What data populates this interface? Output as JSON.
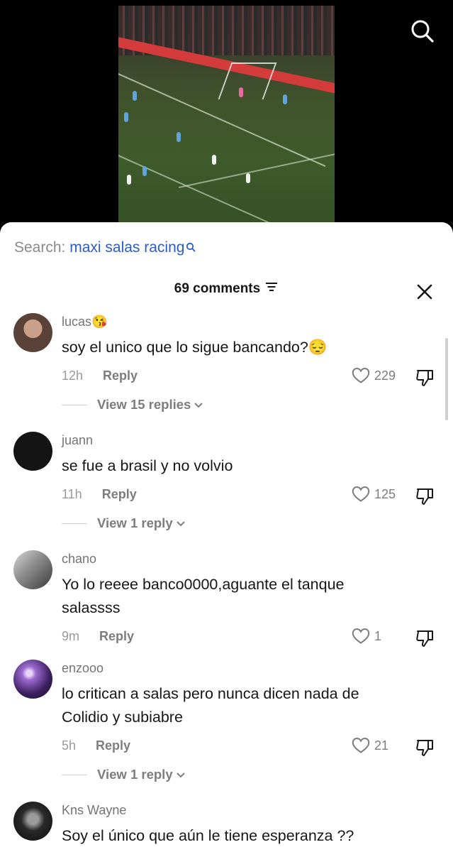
{
  "search": {
    "label": "Search: ",
    "term": "maxi salas racing"
  },
  "header": {
    "comments_count_label": "69 comments"
  },
  "comments": [
    {
      "username": "lucas😘",
      "text": "soy el unico que lo sigue bancando?😔",
      "time": "12h",
      "reply_label": "Reply",
      "likes": "229",
      "view_replies": "View 15 replies"
    },
    {
      "username": "juann",
      "text": "se fue a brasil y no volvio",
      "time": "11h",
      "reply_label": "Reply",
      "likes": "125",
      "view_replies": "View 1 reply"
    },
    {
      "username": "chano",
      "text": "Yo lo reeee banco0000,aguante el tanque salassss",
      "time": "9m",
      "reply_label": "Reply",
      "likes": "1"
    },
    {
      "username": "enzooo",
      "text": "lo critican a salas pero nunca dicen nada de Colidio y subiabre",
      "time": "5h",
      "reply_label": "Reply",
      "likes": "21",
      "view_replies": "View 1 reply"
    },
    {
      "username": "Kns Wayne",
      "text": "Soy el único que aún le tiene esperanza ??"
    }
  ],
  "icons": {
    "video_search": "search-icon",
    "filter": "filter-icon",
    "close": "close-icon",
    "like": "heart-icon",
    "dislike": "thumbs-down-icon",
    "expand": "chevron-down-icon"
  },
  "colors": {
    "search_term": "#2b5cc8",
    "sheet_bg": "#ffffff",
    "video_bg": "#000000"
  }
}
